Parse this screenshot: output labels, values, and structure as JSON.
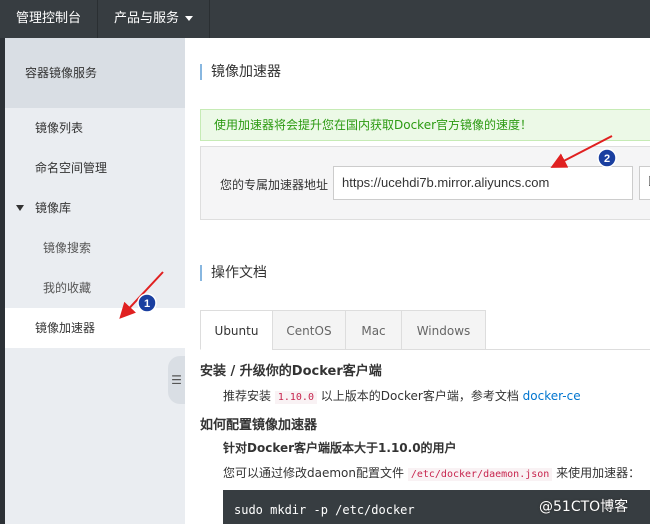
{
  "topbar": {
    "console_label": "管理控制台",
    "products_label": "产品与服务"
  },
  "sidebar": {
    "title": "容器镜像服务",
    "items": [
      {
        "label": "镜像列表"
      },
      {
        "label": "命名空间管理"
      },
      {
        "label": "镜像库"
      },
      {
        "label": "镜像搜索"
      },
      {
        "label": "我的收藏"
      },
      {
        "label": "镜像加速器"
      }
    ]
  },
  "main": {
    "section_title": "镜像加速器",
    "notice": "使用加速器将会提升您在国内获取Docker官方镜像的速度！",
    "address_label": "您的专属加速器地址",
    "address_value": "https://ucehdi7b.mirror.aliyuncs.com",
    "docs_title": "操作文档",
    "tabs": [
      {
        "label": "Ubuntu"
      },
      {
        "label": "CentOS"
      },
      {
        "label": "Mac"
      },
      {
        "label": "Windows"
      }
    ],
    "install_heading": "安装 / 升级你的Docker客户端",
    "install_text_pre": "推荐安装",
    "install_version": "1.10.0",
    "install_text_mid": "以上版本的Docker客户端，参考文档",
    "install_link": "docker-ce",
    "config_heading": "如何配置镜像加速器",
    "config_sub": "针对Docker客户端版本大于1.10.0的用户",
    "config_text_pre": "您可以通过修改daemon配置文件",
    "config_path": "/etc/docker/daemon.json",
    "config_text_post": "来使用加速器：",
    "code_line": "sudo mkdir -p /etc/docker"
  },
  "annotations": {
    "marker_1": "1",
    "marker_2": "2",
    "arrow_color": "#e02020",
    "marker_color": "#1a3fa0"
  },
  "watermark": "@51CTO博客"
}
